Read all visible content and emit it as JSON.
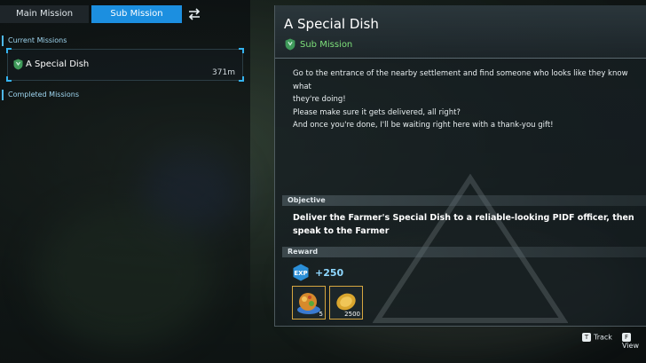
{
  "tabs": {
    "main_label": "Main Mission",
    "sub_label": "Sub Mission"
  },
  "icons": {
    "swap": "swap-arrows-icon",
    "mission": "shield-badge-icon",
    "exp": "exp-badge-icon"
  },
  "sections": {
    "current": "Current Missions",
    "completed": "Completed Missions"
  },
  "missions": [
    {
      "name": "A Special Dish",
      "distance": "371m"
    }
  ],
  "detail": {
    "title": "A Special Dish",
    "type": "Sub Mission",
    "description": [
      "Go to the entrance of the nearby settlement and find someone who looks like they know what",
      "they're doing!",
      "Please make sure it gets delivered, all right?",
      "And once you're done, I'll be waiting right here with a thank-you gift!"
    ],
    "objective_label": "Objective",
    "objective_lines": [
      "Deliver the Farmer's Special Dish to a reliable-looking PIDF officer, then",
      "speak to the Farmer"
    ],
    "reward_label": "Reward",
    "exp_badge": "EXP",
    "exp": "+250",
    "items": [
      {
        "icon": "special-dish-icon",
        "qty": "5"
      },
      {
        "icon": "gold-coin-icon",
        "qty": "2500"
      }
    ]
  },
  "hints": [
    {
      "key": "T",
      "label": "Track"
    },
    {
      "key": "F",
      "label": "View"
    }
  ],
  "colors": {
    "accent": "#1c8fe0",
    "subtype": "#7ee07a",
    "reward_border": "#d6a640"
  }
}
